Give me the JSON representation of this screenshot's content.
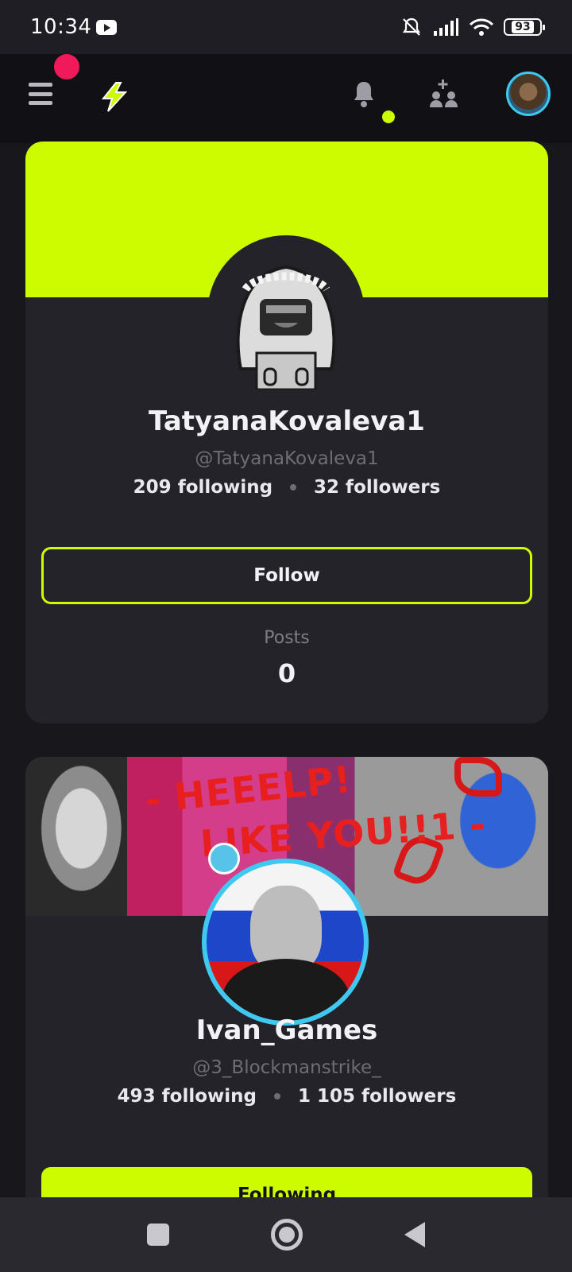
{
  "status_bar": {
    "time": "10:34",
    "battery": "93"
  },
  "profiles": [
    {
      "name": "TatyanaKovaleva1",
      "handle": "@TatyanaKovaleva1",
      "following": "209 following",
      "followers": "32 followers",
      "button": "Follow",
      "posts_label": "Posts",
      "posts_count": "0"
    },
    {
      "name": "Ivan_Games",
      "handle": "@3_Blockmanstrike_",
      "following": "493 following",
      "followers": "1 105 followers",
      "button": "Following",
      "banner_text_1": "- HEEELP!",
      "banner_text_2": "LIKE YOU!!1 -"
    }
  ],
  "colors": {
    "accent": "#cdfc00",
    "notification_red": "#f0195a",
    "background": "#18171c",
    "card": "#242329"
  },
  "icons": [
    "menu-icon",
    "app-logo-icon",
    "bell-icon",
    "add-people-icon",
    "square-icon",
    "home-circle-icon",
    "back-icon"
  ]
}
